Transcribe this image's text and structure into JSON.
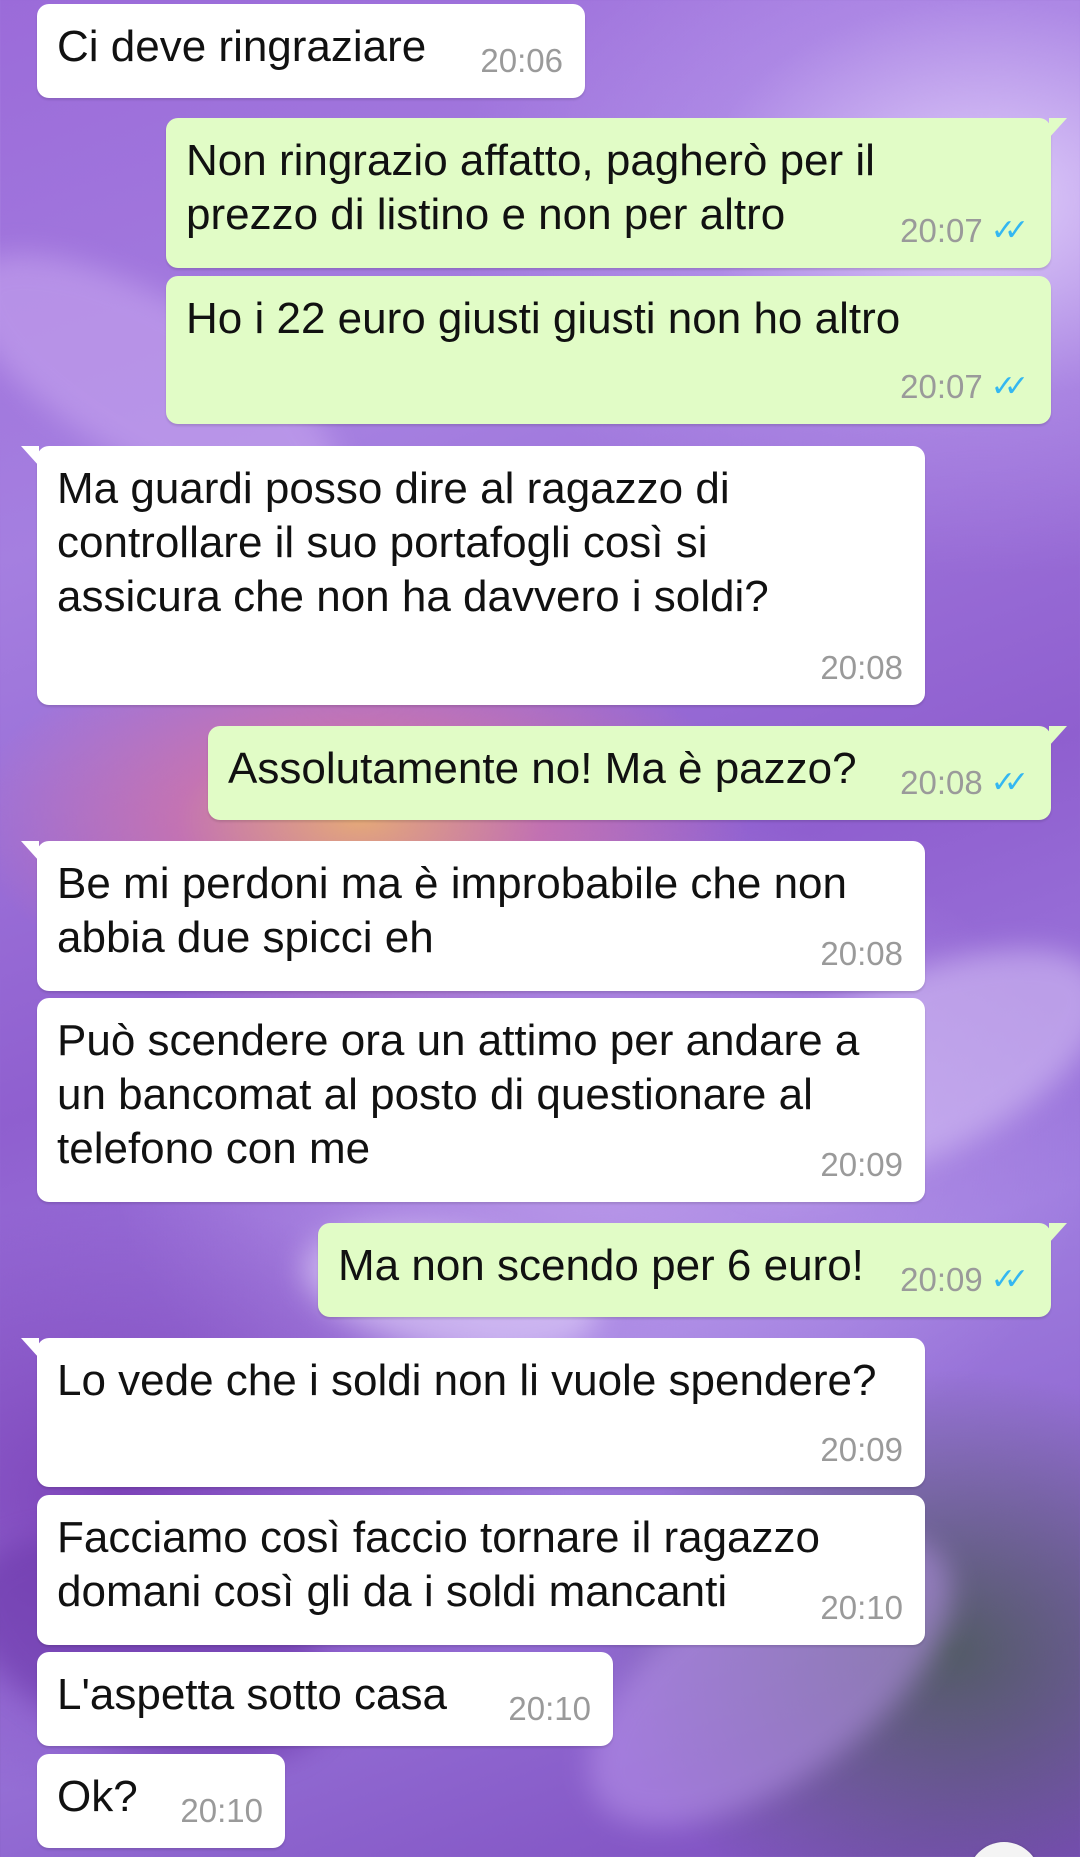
{
  "chat": {
    "messages": [
      {
        "dir": "in",
        "text": "Ci deve ringraziare",
        "time": "20:06",
        "read": false
      },
      {
        "dir": "out",
        "text": "Non ringrazio affatto, pagherò per il\nprezzo di listino e non per altro",
        "time": "20:07",
        "read": true
      },
      {
        "dir": "out",
        "text": "Ho i 22 euro giusti giusti non ho altro",
        "time": "20:07",
        "read": true
      },
      {
        "dir": "in",
        "text": "Ma guardi posso dire al ragazzo di\ncontrollare il suo portafogli così si\nassicura che non ha davvero i soldi?",
        "time": "20:08",
        "read": false
      },
      {
        "dir": "out",
        "text": "Assolutamente no! Ma è pazzo?",
        "time": "20:08",
        "read": true
      },
      {
        "dir": "in",
        "text": "Be mi perdoni ma è improbabile che non\nabbia due spicci eh",
        "time": "20:08",
        "read": false
      },
      {
        "dir": "in",
        "text": "Può scendere ora un attimo per andare a\nun bancomat al posto di questionare al\ntelefono con me",
        "time": "20:09",
        "read": false
      },
      {
        "dir": "out",
        "text": "Ma non scendo per 6 euro!",
        "time": "20:09",
        "read": true
      },
      {
        "dir": "in",
        "text": "Lo vede che i soldi non li vuole spendere?",
        "time": "20:09",
        "read": false
      },
      {
        "dir": "in",
        "text": "Facciamo così faccio tornare il ragazzo\ndomani così gli da i soldi mancanti",
        "time": "20:10",
        "read": false
      },
      {
        "dir": "in",
        "text": "L'aspetta sotto casa",
        "time": "20:10",
        "read": false
      },
      {
        "dir": "in",
        "text": "Ok?",
        "time": "20:10",
        "read": false
      }
    ],
    "read_ticks": "✓✓",
    "scroll_down_icon": "double-chevron-down-icon",
    "tick_color": "#34b7f1",
    "incoming_color": "#ffffff",
    "outgoing_color": "#e1fcc6"
  }
}
